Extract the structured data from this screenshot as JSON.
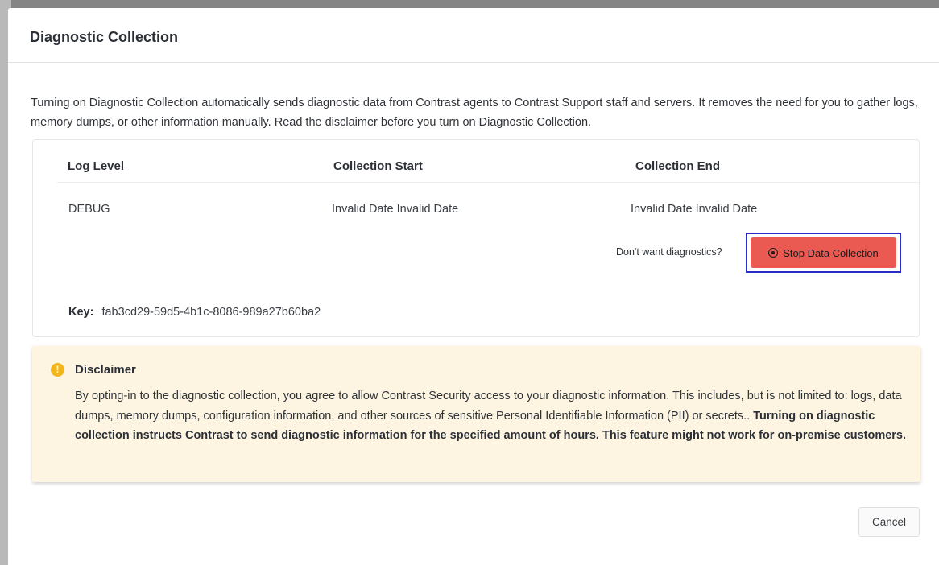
{
  "dialog": {
    "title": "Diagnostic Collection",
    "intro": "Turning on Diagnostic Collection automatically sends diagnostic data from Contrast agents to Contrast Support staff and servers. It removes the need for you to gather logs, memory dumps, or other information manually. Read the disclaimer before you turn on Diagnostic Collection."
  },
  "table": {
    "headers": {
      "log_level": "Log Level",
      "collection_start": "Collection Start",
      "collection_end": "Collection End"
    },
    "row": {
      "log_level": "DEBUG",
      "collection_start": "Invalid Date Invalid Date",
      "collection_end": "Invalid Date Invalid Date"
    },
    "stop": {
      "hint": "Don't want diagnostics?",
      "button_label": "Stop Data Collection",
      "button_color": "#ea5a52",
      "icon": "radio-record-icon"
    },
    "key": {
      "label": "Key:",
      "value": "fab3cd29-59d5-4b1c-8086-989a27b60ba2"
    }
  },
  "disclaimer": {
    "icon": "warning-icon",
    "icon_glyph": "!",
    "title": "Disclaimer",
    "body": "By opting-in to the diagnostic collection, you agree to allow Contrast Security access to your diagnostic information. This includes, but is not limited to: logs, data dumps, memory dumps, configuration information, and other sources of sensitive Personal Identifiable Information (PII) or secrets.",
    "emphasis": "Turning on diagnostic collection instructs Contrast to send diagnostic information for the specified amount of hours. This feature might not work for on-premise customers.",
    "background": "#fdf5e2"
  },
  "footer": {
    "cancel_label": "Cancel"
  }
}
